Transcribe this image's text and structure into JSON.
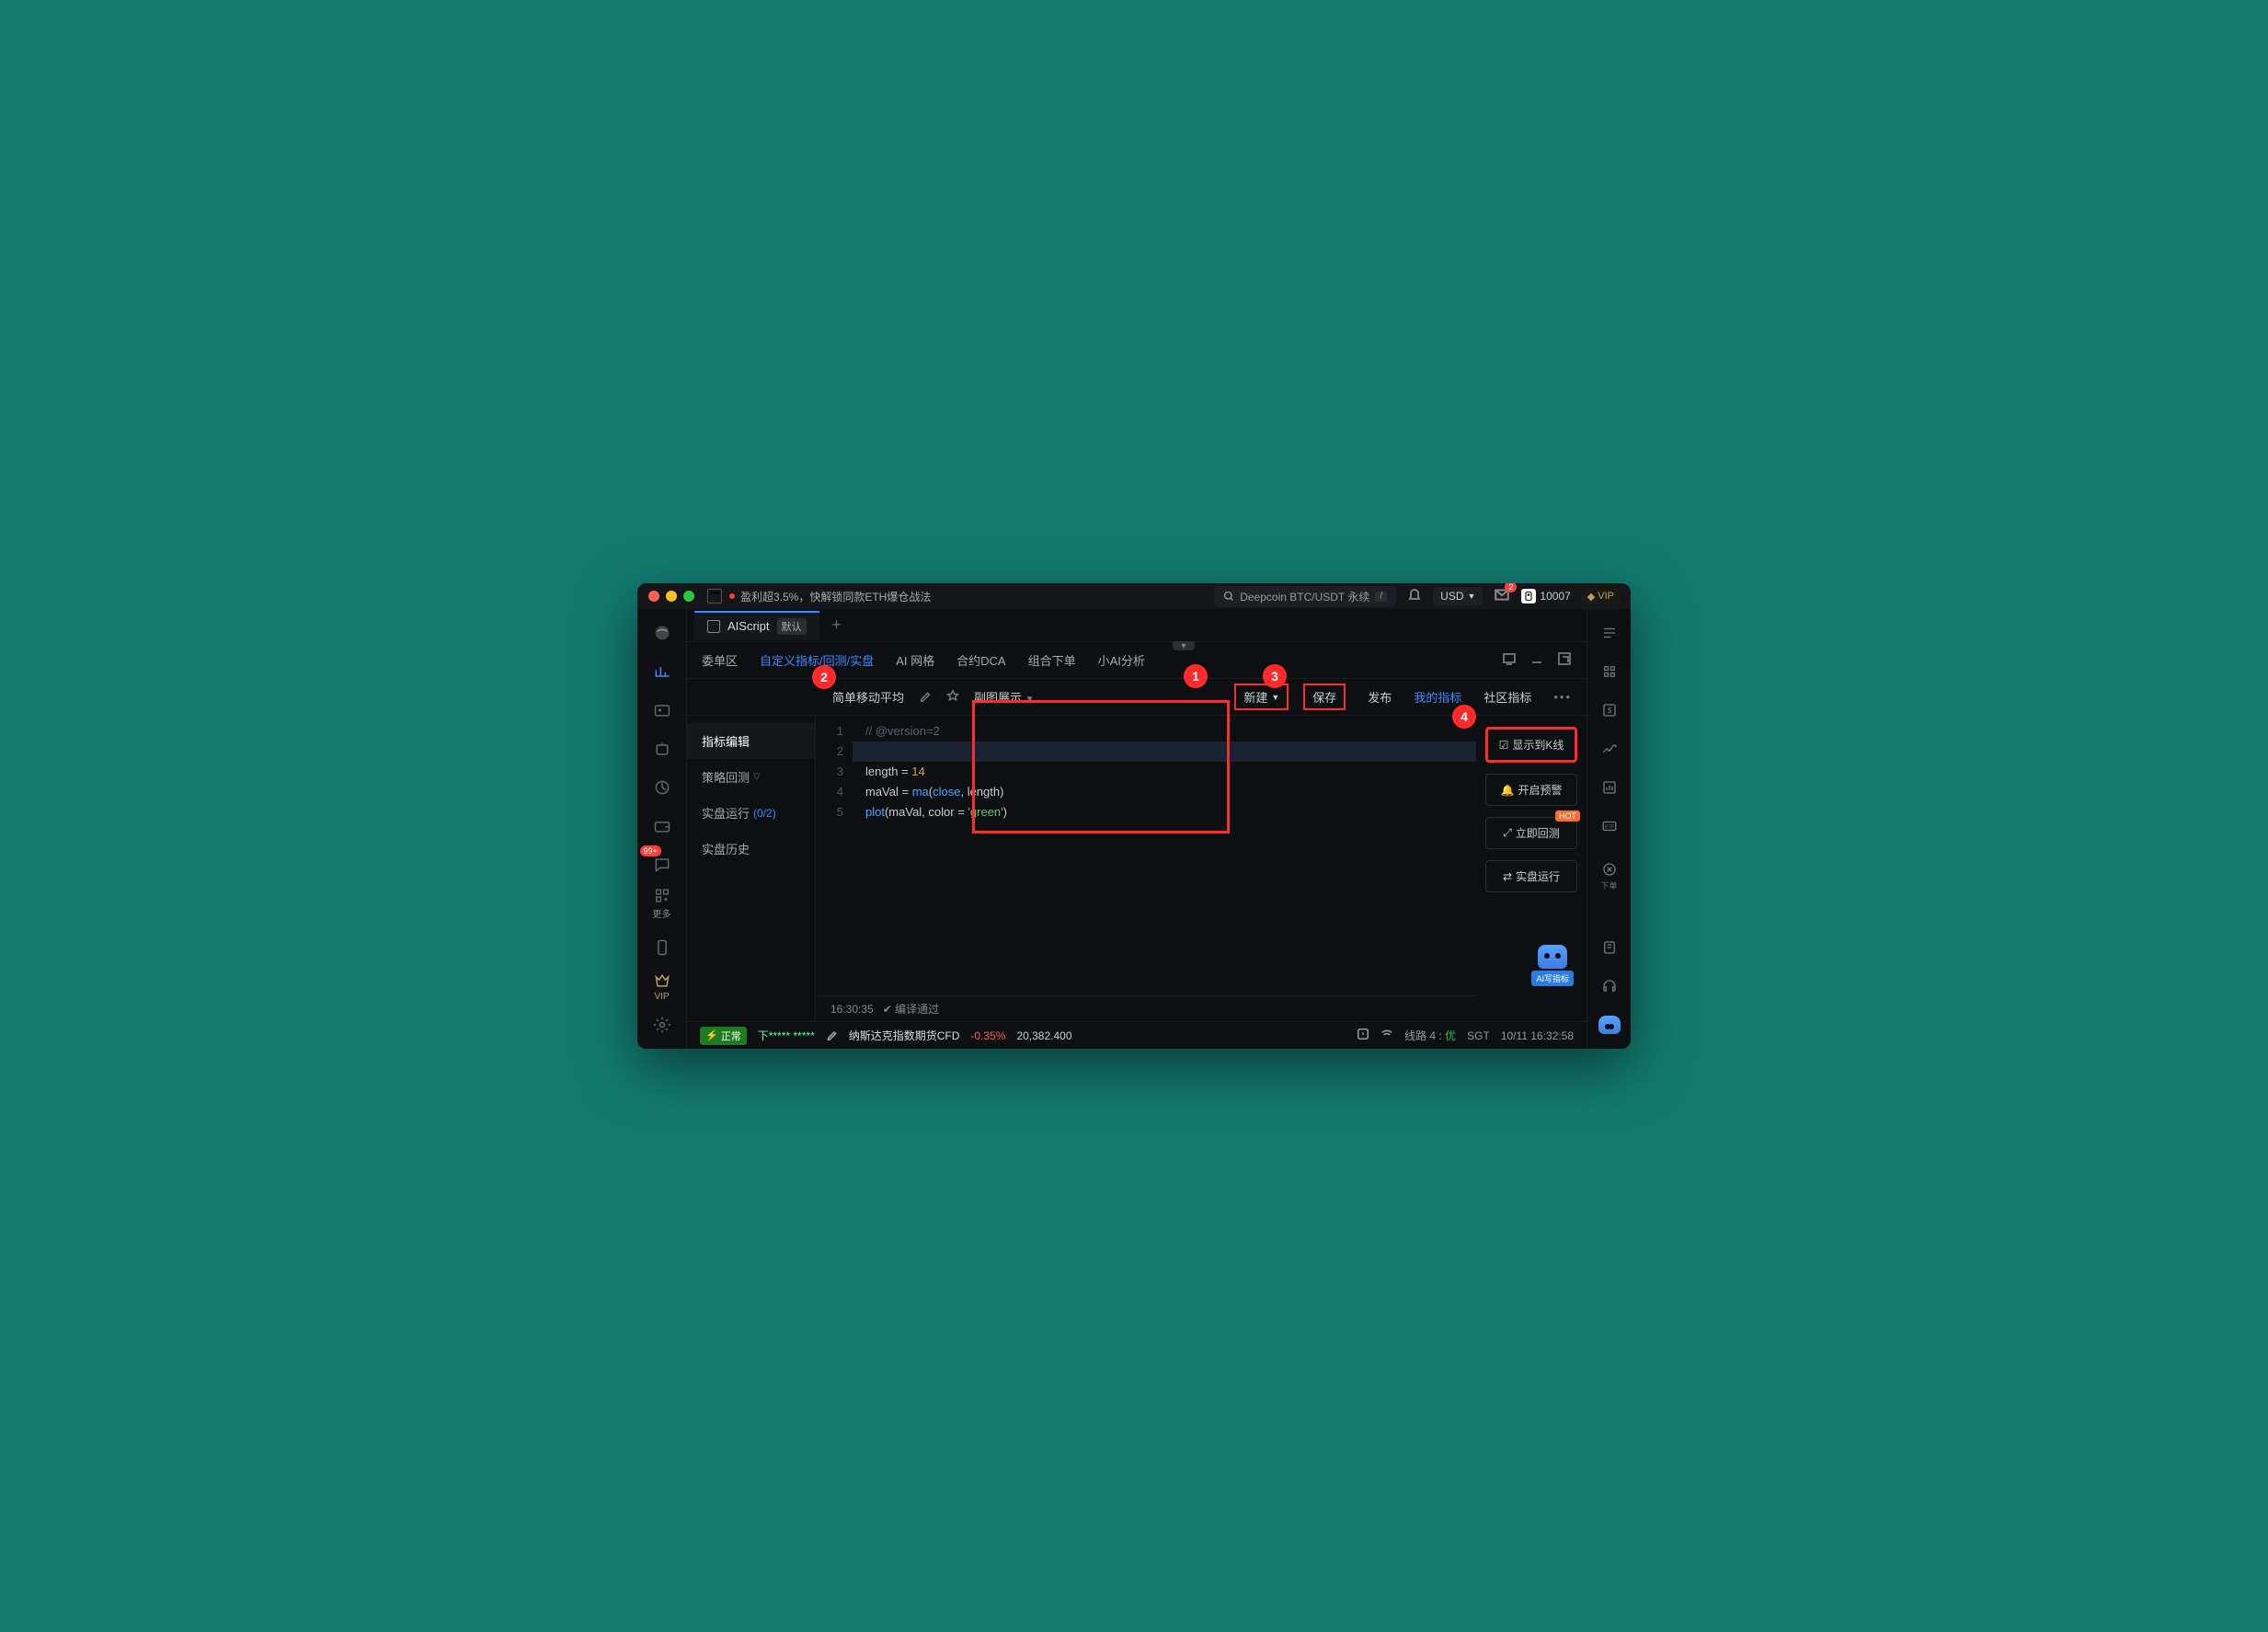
{
  "titlebar": {
    "ticker": "盈利超3.5%，快解锁同款ETH爆仓战法",
    "search": "Deepcoin BTC/USDT 永续",
    "currency": "USD",
    "mail_badge": "2",
    "points": "10007",
    "vip": "VIP"
  },
  "file_tab": {
    "name": "AIScript",
    "tag": "默认"
  },
  "nav": {
    "items": [
      "委单区",
      "自定义指标/回测/实盘",
      "AI 网格",
      "合约DCA",
      "组合下单",
      "小AI分析"
    ],
    "active": 1
  },
  "toolbar": {
    "script_name": "简单移动平均",
    "subchart": "副图展示",
    "new": "新建",
    "save": "保存",
    "publish": "发布",
    "my_indicators": "我的指标",
    "community": "社区指标"
  },
  "left_panel": {
    "items": [
      {
        "label": "指标编辑",
        "active": true
      },
      {
        "label": "策略回测",
        "caret": true
      },
      {
        "label": "实盘运行",
        "fraction": "(0/2)"
      },
      {
        "label": "实盘历史"
      }
    ]
  },
  "code": {
    "lines": [
      {
        "n": "1",
        "html": "<span class='k-comment'>// @version=2</span>"
      },
      {
        "n": "2",
        "html": "",
        "sel": true
      },
      {
        "n": "3",
        "html": "length = <span class='k-num'>14</span>"
      },
      {
        "n": "4",
        "html": "maVal = <span class='k-func'>ma</span>(<span class='k-keyword'>close</span>, length)"
      },
      {
        "n": "5",
        "html": "<span class='k-func'>plot</span>(maVal, color = <span class='k-str'>'green'</span>)"
      }
    ]
  },
  "right_actions": {
    "show_kline": "显示到K线",
    "alert": "开启预警",
    "backtest": "立即回测",
    "live": "实盘运行",
    "hot": "HOT"
  },
  "status": {
    "time": "16:30:35",
    "msg": "编译通过"
  },
  "ai_tag": "AI写指标",
  "circles": {
    "c1": "1",
    "c2": "2",
    "c3": "3",
    "c4": "4"
  },
  "left_rail": {
    "more": "更多",
    "vip": "VIP",
    "msg_badge": "99+"
  },
  "right_rail": {
    "order": "下单",
    "etf": "ETF",
    "dollar": "$"
  },
  "footer": {
    "status": "正常",
    "mask": "下***** *****",
    "instrument": "纳斯达克指数期货CFD",
    "change": "-0.35%",
    "price": "20,382.400",
    "route": "线路 4 :",
    "route_quality": "优",
    "tz": "SGT",
    "date": "10/11 16:32:58"
  }
}
